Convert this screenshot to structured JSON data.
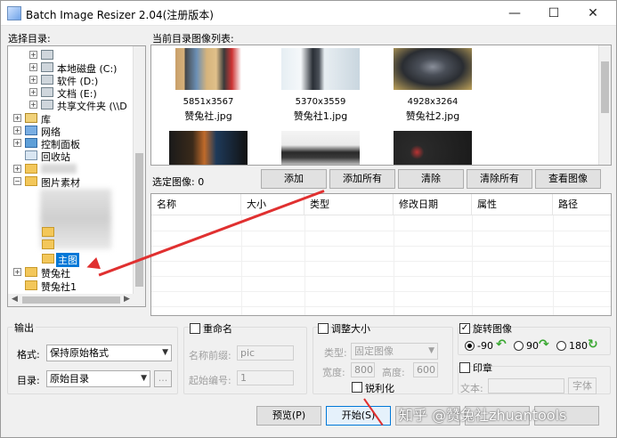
{
  "window": {
    "title": "Batch Image Resizer 2.04(注册版本)",
    "controls": [
      "—",
      "☐",
      "✕"
    ]
  },
  "left": {
    "label": "选择目录:",
    "tree": [
      {
        "text": "本地磁盘 (C:)",
        "icon": "drive-icon"
      },
      {
        "text": "软件 (D:)",
        "icon": "drive-icon"
      },
      {
        "text": "文档 (E:)",
        "icon": "drive-icon"
      },
      {
        "text": "共享文件夹 (\\\\D",
        "icon": "drive-icon"
      },
      {
        "text": "库",
        "icon": "library-icon"
      },
      {
        "text": "网络",
        "icon": "network-icon"
      },
      {
        "text": "控制面板",
        "icon": "control-panel-icon"
      },
      {
        "text": "回收站",
        "icon": "recycle-bin-icon"
      },
      {
        "text": "图片素材",
        "icon": "folder-icon"
      },
      {
        "text": "主图",
        "icon": "folder-icon"
      },
      {
        "text": "赞兔社",
        "icon": "folder-icon"
      },
      {
        "text": "赞兔社1",
        "icon": "folder-icon"
      }
    ]
  },
  "right": {
    "label": "当前目录图像列表:",
    "thumbnails": [
      {
        "dims": "5851x3567",
        "name": "赞兔社.jpg"
      },
      {
        "dims": "5370x3559",
        "name": "赞兔社1.jpg"
      },
      {
        "dims": "4928x3264",
        "name": "赞兔社2.jpg"
      }
    ],
    "selected_label": "选定图像: 0",
    "buttons": {
      "add": "添加",
      "add_all": "添加所有",
      "clear": "清除",
      "clear_all": "清除所有",
      "view": "查看图像"
    },
    "columns": [
      "名称",
      "大小",
      "类型",
      "修改日期",
      "属性",
      "路径"
    ]
  },
  "output": {
    "title": "输出",
    "format_label": "格式:",
    "format_value": "保持原始格式",
    "dir_label": "目录:",
    "dir_value": "原始目录",
    "browse": "..."
  },
  "rename": {
    "title": "重命名",
    "prefix_label": "名称前缀:",
    "prefix_value": "pic",
    "start_label": "起始编号:",
    "start_value": "1"
  },
  "resize": {
    "title": "调整大小",
    "type_label": "类型:",
    "type_value": "固定图像",
    "width_label": "宽度:",
    "width_value": "800",
    "height_label": "高度:",
    "height_value": "600",
    "sharpen": "锐利化"
  },
  "rotate": {
    "title": "旋转图像",
    "opt1": "-90",
    "opt2": "90",
    "opt3": "180"
  },
  "stamp": {
    "title": "印章",
    "text_label": "文本:",
    "font_btn": "字体"
  },
  "footer": {
    "preview": "预览(P)",
    "start": "开始(S)",
    "watermark": "知乎 @赞兔社zhuantools"
  },
  "colors": {
    "accent": "#0078d7",
    "arrow": "#e03030",
    "rotate_arrow": "#3aa832"
  }
}
